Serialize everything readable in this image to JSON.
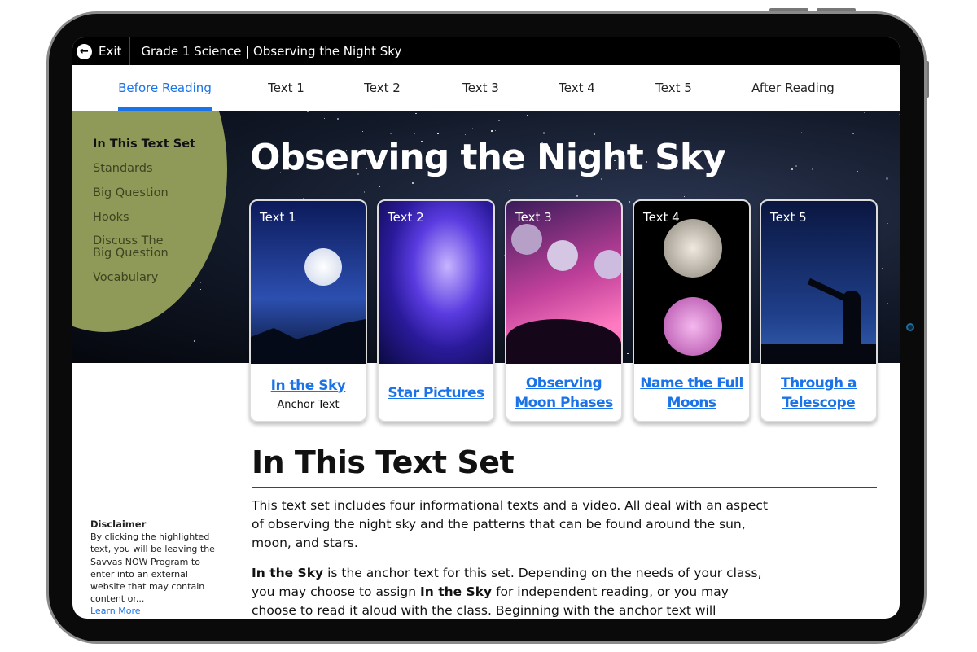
{
  "topbar": {
    "exit_label": "Exit",
    "breadcrumb": "Grade 1 Science | Observing the Night Sky"
  },
  "tabs": [
    {
      "label": "Before Reading",
      "active": true
    },
    {
      "label": "Text 1"
    },
    {
      "label": "Text 2"
    },
    {
      "label": "Text 3"
    },
    {
      "label": "Text 4"
    },
    {
      "label": "Text 5"
    },
    {
      "label": "After Reading"
    }
  ],
  "sidebar": {
    "items": [
      "In This Text Set",
      "Standards",
      "Big Question",
      "Hooks",
      "Discuss The Big Question",
      "Vocabulary"
    ]
  },
  "hero": {
    "title": "Observing the Night Sky"
  },
  "cards": [
    {
      "label": "Text 1",
      "title": "In the Sky",
      "subtitle": "Anchor Text"
    },
    {
      "label": "Text 2",
      "title": "Star Pictures"
    },
    {
      "label": "Text 3",
      "title": "Observing Moon Phases"
    },
    {
      "label": "Text 4",
      "title": "Name the Full Moons"
    },
    {
      "label": "Text 5",
      "title": "Through a Telescope"
    }
  ],
  "content": {
    "heading": "In This Text Set",
    "p1": "This text set includes four informational texts and a video. All deal with an aspect of observing the night sky and the patterns that can be found around the sun, moon, and stars.",
    "p2_bold1": "In the Sky",
    "p2_a": " is the anchor text for this set. Depending on the needs of your class, you may choose to assign ",
    "p2_bold2": "In the Sky",
    "p2_b": " for independent reading, or you may choose to read it aloud with the class. Beginning with the anchor text will"
  },
  "disclaimer": {
    "title": "Disclaimer",
    "text": "By clicking the highlighted text, you will be leaving the Savvas NOW Program to enter into an external website that may contain content or...",
    "link": "Learn More"
  },
  "colors": {
    "accent": "#1a73e8",
    "sidebar_circle": "#8f9a58"
  }
}
